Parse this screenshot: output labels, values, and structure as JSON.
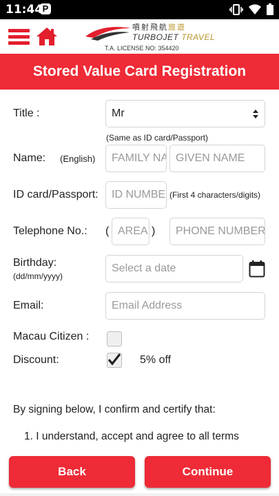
{
  "status_bar": {
    "time": "11:44",
    "p_badge": "P"
  },
  "header": {
    "logo_cn_1": "噴射飛航",
    "logo_cn_2": "旅遊",
    "logo_en_1": "TURBOJET",
    "logo_en_2": "TRAVEL",
    "license": "T.A. LICENSE NO: 354420"
  },
  "page_title": "Stored Value Card Registration",
  "form": {
    "title_label": "Title :",
    "title_value": "Mr",
    "title_hint": "(Same as ID card/Passport)",
    "name_label": "Name:",
    "name_sub": "(English)",
    "family_placeholder": "FAMILY NAME",
    "given_placeholder": "GIVEN NAME",
    "id_label": "ID card/Passport:",
    "id_placeholder": "ID NUMBER",
    "id_hint": "(First 4 characters/digits)",
    "tel_label": "Telephone No.:",
    "tel_open": "(",
    "tel_close": ")",
    "area_placeholder": "AREA",
    "phone_placeholder": "PHONE NUMBER",
    "birthday_label": "Birthday:",
    "birthday_sub": "(dd/mm/yyyy)",
    "date_placeholder": "Select a date",
    "email_label": "Email:",
    "email_placeholder": "Email Address",
    "macau_label": "Macau Citizen :",
    "macau_checked": false,
    "discount_label": "Discount:",
    "discount_checked": true,
    "discount_value": "5% off"
  },
  "terms": {
    "intro": "By signing below, I confirm and certify that:",
    "item1": "1. I understand, accept and agree to all terms"
  },
  "buttons": {
    "back": "Back",
    "continue": "Continue"
  },
  "colors": {
    "brand_red": "#ee2b36",
    "gold": "#b9952c"
  }
}
